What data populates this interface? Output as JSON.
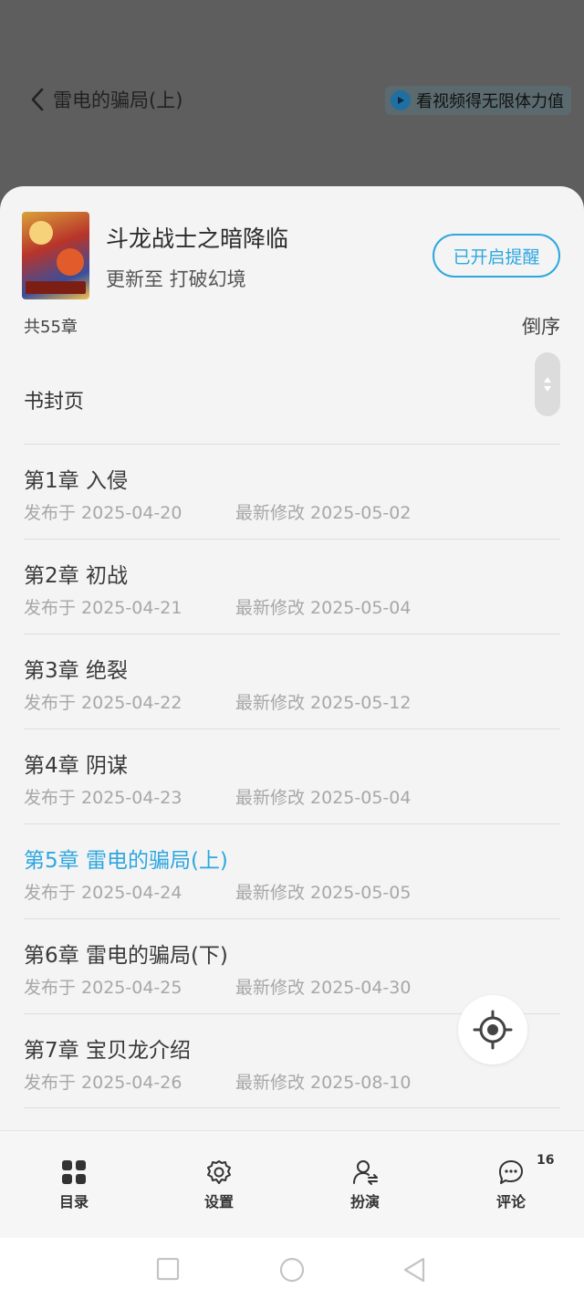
{
  "reader": {
    "chapter_title": "雷电的骗局(上)",
    "video_reward_text": "看视频得无限体力值"
  },
  "book": {
    "title": "斗龙战士之暗降临",
    "update_text": "更新至 打破幻境",
    "remind_label": "已开启提醒"
  },
  "toc": {
    "count_text": "共55章",
    "order_label": "倒序",
    "cover_page_label": "书封页",
    "chapters": [
      {
        "title": "第1章 入侵",
        "published": "发布于 2025-04-20",
        "modified": "最新修改 2025-05-02"
      },
      {
        "title": "第2章 初战",
        "published": "发布于 2025-04-21",
        "modified": "最新修改 2025-05-04"
      },
      {
        "title": "第3章 绝裂",
        "published": "发布于 2025-04-22",
        "modified": "最新修改 2025-05-12"
      },
      {
        "title": "第4章 阴谋",
        "published": "发布于 2025-04-23",
        "modified": "最新修改 2025-05-04"
      },
      {
        "title": "第5章 雷电的骗局(上)",
        "published": "发布于 2025-04-24",
        "modified": "最新修改 2025-05-05"
      },
      {
        "title": "第6章 雷电的骗局(下)",
        "published": "发布于 2025-04-25",
        "modified": "最新修改 2025-04-30"
      },
      {
        "title": "第7章 宝贝龙介绍",
        "published": "发布于 2025-04-26",
        "modified": "最新修改 2025-08-10"
      }
    ]
  },
  "tabs": {
    "catalog": "目录",
    "settings": "设置",
    "roleplay": "扮演",
    "comments": "评论",
    "comments_badge": "16"
  },
  "colors": {
    "accent": "#2ea7e0",
    "sheet_bg": "#f4f4f4",
    "overlay": "#5b5b5b"
  }
}
